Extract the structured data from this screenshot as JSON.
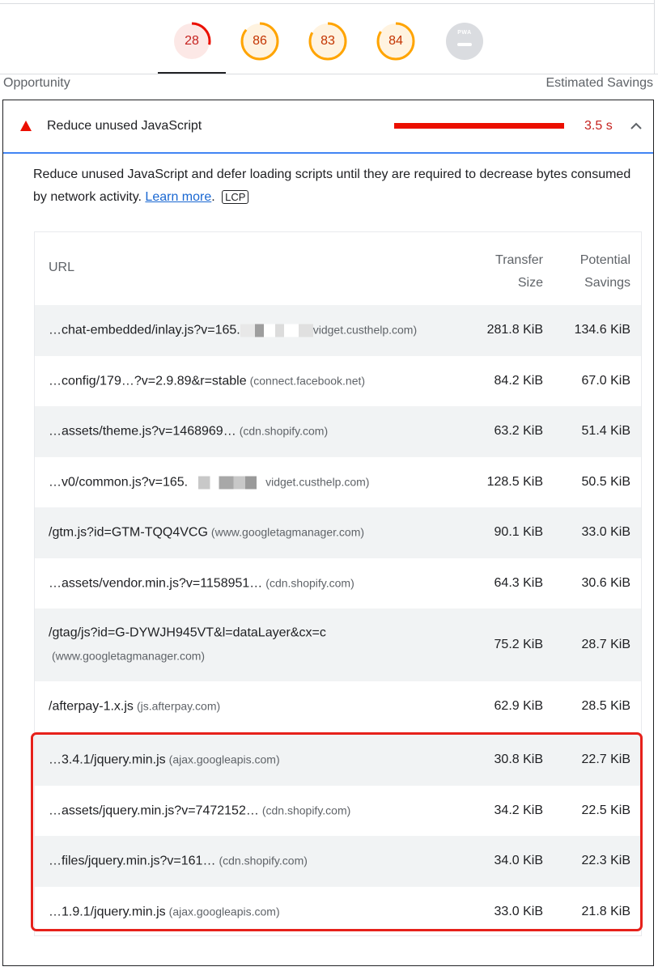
{
  "scores": [
    {
      "label": "28",
      "color": "#eb0f00",
      "value": 28
    },
    {
      "label": "86",
      "color": "#ffa400",
      "value": 86
    },
    {
      "label": "83",
      "color": "#ffa400",
      "value": 83
    },
    {
      "label": "84",
      "color": "#ffa400",
      "value": 84
    },
    {
      "label": "PWA",
      "color": "#dadce0"
    }
  ],
  "section": {
    "left_label": "Opportunity",
    "right_label": "Estimated Savings"
  },
  "audit": {
    "title": "Reduce unused JavaScript",
    "savings": "3.5 s",
    "description": "Reduce unused JavaScript and defer loading scripts until they are required to decrease bytes consumed by network activity.",
    "learn_more": "Learn more",
    "period": ".",
    "badge": "LCP"
  },
  "table": {
    "col_url": "URL",
    "col_size_line1": "Transfer",
    "col_size_line2": "Size",
    "col_savings_line1": "Potential",
    "col_savings_line2": "Savings",
    "rows": [
      {
        "url": "…chat-embedded/inlay.js?v=165.",
        "domain": "vidget.custhelp.com)",
        "size": "281.8 KiB",
        "savings": "134.6 KiB"
      },
      {
        "url": "…config/179…?v=2.9.89&r=stable",
        "domain": "(connect.facebook.net)",
        "size": "84.2 KiB",
        "savings": "67.0 KiB"
      },
      {
        "url": "…assets/theme.js?v=1468969…",
        "domain": "(cdn.shopify.com)",
        "size": "63.2 KiB",
        "savings": "51.4 KiB"
      },
      {
        "url": "…v0/common.js?v=165.",
        "domain": "vidget.custhelp.com)",
        "size": "128.5 KiB",
        "savings": "50.5 KiB"
      },
      {
        "url": "/gtm.js?id=GTM-TQQ4VCG",
        "domain": "(www.googletagmanager.com)",
        "size": "90.1 KiB",
        "savings": "33.0 KiB"
      },
      {
        "url": "…assets/vendor.min.js?v=1158951…",
        "domain": "(cdn.shopify.com)",
        "size": "64.3 KiB",
        "savings": "30.6 KiB"
      },
      {
        "url": "/gtag/js?id=G-DYWJH945VT&l=dataLayer&cx=c",
        "domain": "(www.googletagmanager.com)",
        "size": "75.2 KiB",
        "savings": "28.7 KiB"
      },
      {
        "url": "/afterpay-1.x.js",
        "domain": "(js.afterpay.com)",
        "size": "62.9 KiB",
        "savings": "28.5 KiB"
      },
      {
        "url": "…3.4.1/jquery.min.js",
        "domain": "(ajax.googleapis.com)",
        "size": "30.8 KiB",
        "savings": "22.7 KiB"
      },
      {
        "url": "…assets/jquery.min.js?v=7472152…",
        "domain": "(cdn.shopify.com)",
        "size": "34.2 KiB",
        "savings": "22.5 KiB"
      },
      {
        "url": "…files/jquery.min.js?v=161…",
        "domain": "(cdn.shopify.com)",
        "size": "34.0 KiB",
        "savings": "22.3 KiB"
      },
      {
        "url": "…1.9.1/jquery.min.js",
        "domain": "(ajax.googleapis.com)",
        "size": "33.0 KiB",
        "savings": "21.8 KiB"
      }
    ]
  },
  "colors": {
    "fail": "#eb0f00",
    "average": "#ffa400",
    "highlight": "#e6211b",
    "link": "#1967d2",
    "focus": "#4285f4"
  }
}
